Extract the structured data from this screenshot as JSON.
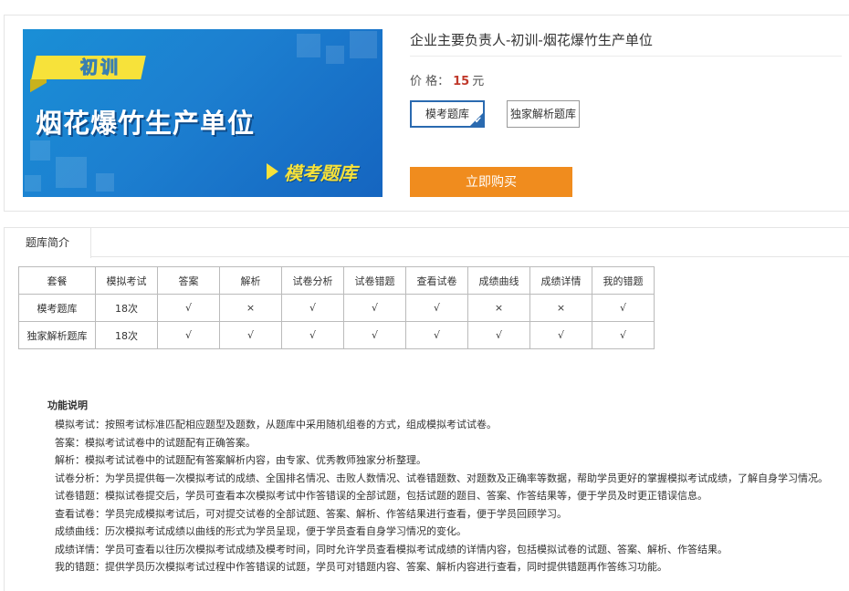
{
  "product": {
    "banner": {
      "tag": "初训",
      "title": "烟花爆竹生产单位",
      "subtitle": "模考题库"
    },
    "title": "企业主要负责人-初训-烟花爆竹生产单位",
    "price_label": "价 格：",
    "price_value": "15",
    "price_unit": "元",
    "options": [
      {
        "label": "模考题库",
        "selected": true
      },
      {
        "label": "独家解析题库",
        "selected": false
      }
    ],
    "buy_label": "立即购买"
  },
  "tabs": [
    {
      "label": "题库简介",
      "active": true
    }
  ],
  "comparison": {
    "headers": [
      "套餐",
      "模拟考试",
      "答案",
      "解析",
      "试卷分析",
      "试卷错题",
      "查看试卷",
      "成绩曲线",
      "成绩详情",
      "我的错题"
    ],
    "rows": [
      [
        "模考题库",
        "18次",
        "√",
        "×",
        "√",
        "√",
        "√",
        "×",
        "×",
        "√"
      ],
      [
        "独家解析题库",
        "18次",
        "√",
        "√",
        "√",
        "√",
        "√",
        "√",
        "√",
        "√"
      ]
    ]
  },
  "features": {
    "heading": "功能说明",
    "lines": [
      "模拟考试：按照考试标准匹配相应题型及题数，从题库中采用随机组卷的方式，组成模拟考试试卷。",
      "答案：模拟考试试卷中的试题配有正确答案。",
      "解析：模拟考试试卷中的试题配有答案解析内容，由专家、优秀教师独家分析整理。",
      "试卷分析：为学员提供每一次模拟考试的成绩、全国排名情况、击败人数情况、试卷错题数、对题数及正确率等数据，帮助学员更好的掌握模拟考试成绩，了解自身学习情况。",
      "试卷错题：模拟试卷提交后，学员可查看本次模拟考试中作答错误的全部试题，包括试题的题目、答案、作答结果等，便于学员及时更正错误信息。",
      "查看试卷：学员完成模拟考试后，可对提交试卷的全部试题、答案、解析、作答结果进行查看，便于学员回顾学习。",
      "成绩曲线：历次模拟考试成绩以曲线的形式为学员呈现，便于学员查看自身学习情况的变化。",
      "成绩详情：学员可查看以往历次模拟考试成绩及模考时间，同时允许学员查看模拟考试成绩的详情内容，包括模拟试卷的试题、答案、解析、作答结果。",
      "我的错题：提供学员历次模拟考试过程中作答错误的试题，学员可对错题内容、答案、解析内容进行查看，同时提供错题再作答练习功能。"
    ]
  },
  "icons": {
    "play": "play-triangle-icon",
    "check": "checkmark-icon"
  },
  "colors": {
    "accent": "#f08c1e",
    "price": "#c0392b",
    "selected_border": "#2a6ab0",
    "banner_blue": "#1a8fd6",
    "banner_yellow": "#f7e23a"
  }
}
